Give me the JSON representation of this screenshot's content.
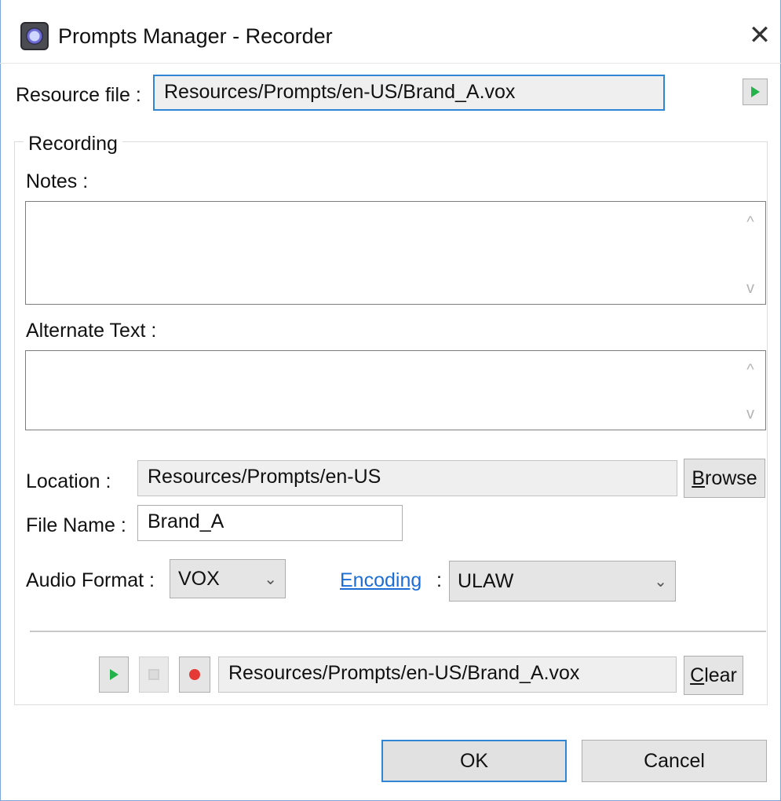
{
  "window": {
    "title": "Prompts Manager - Recorder",
    "close_glyph": "✕"
  },
  "resource": {
    "label": "Resource file :",
    "value": "Resources/Prompts/en-US/Brand_A.vox"
  },
  "recording": {
    "group_label": "Recording",
    "notes_label": "Notes :",
    "notes_value": "",
    "alternate_label": "Alternate Text :",
    "alternate_value": "",
    "location_label": "Location :",
    "location_value": "Resources/Prompts/en-US",
    "browse": {
      "mnemonic": "B",
      "rest": "rowse"
    },
    "filename_label": "File Name :",
    "filename_value": "Brand_A",
    "audio_format_label": "Audio Format :",
    "audio_format_value": "VOX",
    "encoding_link": "Encoding",
    "encoding_colon": ":",
    "encoding_value": "ULAW"
  },
  "player": {
    "path": "Resources/Prompts/en-US/Brand_A.vox",
    "clear": {
      "mnemonic": "C",
      "rest": "lear"
    }
  },
  "footer": {
    "ok_label": "OK",
    "cancel_label": "Cancel"
  },
  "icons": {
    "play": "play-icon",
    "stop": "stop-icon",
    "record": "record-icon",
    "scroll_up": "^",
    "scroll_down": "v"
  },
  "colors": {
    "accent": "#2f86d4",
    "link": "#1c6ed6",
    "play": "#24b24a",
    "record": "#e53935"
  }
}
